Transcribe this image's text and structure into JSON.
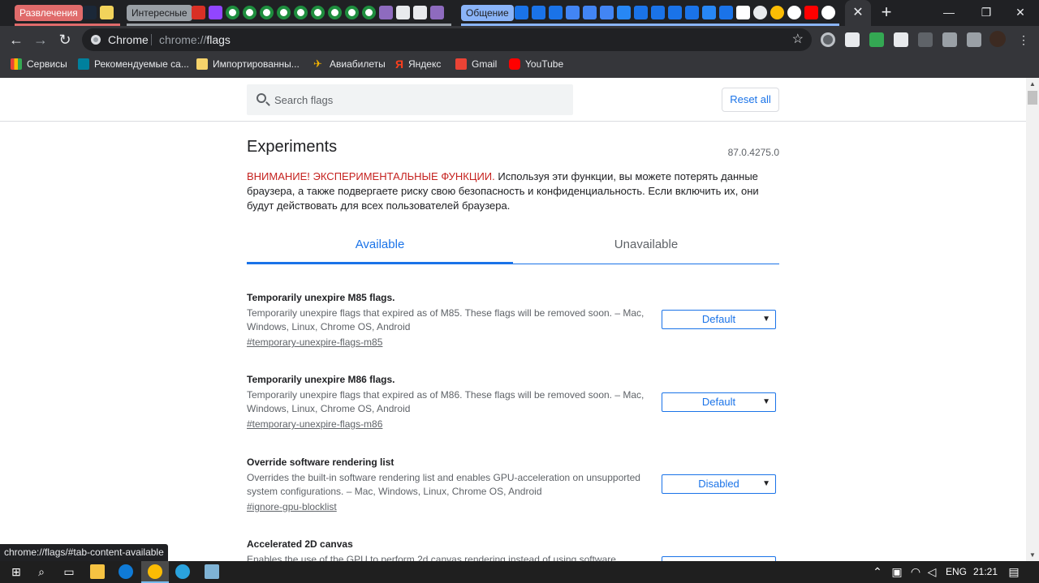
{
  "tabstrip": {
    "groups": [
      {
        "label": "Развлечения",
        "color": "#e06b6b"
      },
      {
        "label": "Интересные",
        "color": "#9aa0a6"
      },
      {
        "label": "Общение",
        "color": "#8ab4f8"
      }
    ],
    "close_glyph": "✕",
    "new_tab_glyph": "+",
    "window_controls": {
      "minimize": "—",
      "maximize": "❐",
      "close": "✕"
    }
  },
  "toolbar": {
    "back": "←",
    "forward": "→",
    "reload": "↻",
    "omnibox": {
      "chip_label": "Chrome",
      "url_prefix": "chrome://",
      "url_host": "flags"
    },
    "bookmark_star": "☆"
  },
  "bookmarks": [
    {
      "label": "Сервисы",
      "icon": "apps-grid-icon"
    },
    {
      "label": "Рекомендуемые са...",
      "icon": "bing-icon"
    },
    {
      "label": "Импортированны...",
      "icon": "folder-icon"
    },
    {
      "label": "Авиабилеты",
      "icon": "plane-icon"
    },
    {
      "label": "Яндекс",
      "icon": "yandex-icon"
    },
    {
      "label": "Gmail",
      "icon": "gmail-icon"
    },
    {
      "label": "YouTube",
      "icon": "youtube-icon"
    }
  ],
  "page": {
    "search_placeholder": "Search flags",
    "reset_label": "Reset all",
    "title": "Experiments",
    "version": "87.0.4275.0",
    "warning_red": "ВНИМАНИЕ! ЭКСПЕРИМЕНТАЛЬНЫЕ ФУНКЦИИ.",
    "warning_text": " Используя эти функции, вы можете потерять данные браузера, а также подвергаете риску свою безопасность и конфиденциальность. Если включить их, они будут действовать для всех пользователей браузера.",
    "tabs": [
      {
        "label": "Available",
        "selected": true
      },
      {
        "label": "Unavailable",
        "selected": false
      }
    ],
    "flags": [
      {
        "name": "Temporarily unexpire M85 flags.",
        "description": "Temporarily unexpire flags that expired as of M85. These flags will be removed soon. – Mac, Windows, Linux, Chrome OS, Android",
        "link": "#temporary-unexpire-flags-m85",
        "value": "Default"
      },
      {
        "name": "Temporarily unexpire M86 flags.",
        "description": "Temporarily unexpire flags that expired as of M86. These flags will be removed soon. – Mac, Windows, Linux, Chrome OS, Android",
        "link": "#temporary-unexpire-flags-m86",
        "value": "Default"
      },
      {
        "name": "Override software rendering list",
        "description": "Overrides the built-in software rendering list and enables GPU-acceleration on unsupported system configurations. – Mac, Windows, Linux, Chrome OS, Android",
        "link": "#ignore-gpu-blocklist",
        "value": "Disabled"
      },
      {
        "name": "Accelerated 2D canvas",
        "description": "Enables the use of the GPU to perform 2d canvas rendering instead of using software",
        "link": "",
        "value": ""
      }
    ],
    "status_url": "chrome://flags/#tab-content-available"
  },
  "taskbar": {
    "language": "ENG",
    "time": "21:21"
  }
}
